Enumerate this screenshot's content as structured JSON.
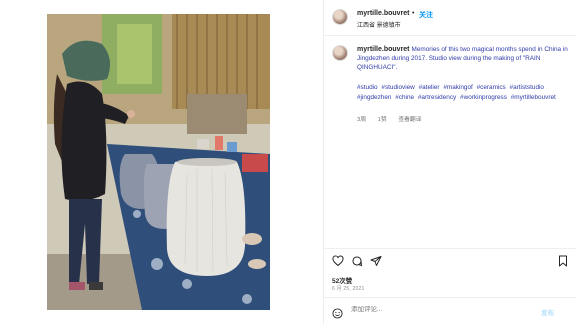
{
  "post": {
    "username": "myrtille.bouvret",
    "follow_label": "关注",
    "location": "江西省 景德镇市",
    "caption": "Memories of this two magical months spend in China in Jingdezhen during 2017. Studio view during the making of \"RAIN QINGHUACI\".",
    "hashtags": [
      "#studio",
      "#studioview",
      "#atelier",
      "#makingof",
      "#ceramics",
      "#artiststudio",
      "#jingdezhen",
      "#chine",
      "#artresidency",
      "#workinprogress",
      "#myrtillebouvret"
    ],
    "caption_time": "3周",
    "caption_likes": "1赞",
    "reply_label": "查看翻译",
    "likes": "52次赞",
    "date": "6 月 25, 2021",
    "comment_placeholder": "添加评论...",
    "post_button": "发布"
  },
  "icons": {
    "like": "heart-icon",
    "comment": "comment-icon",
    "share": "share-icon",
    "save": "bookmark-icon",
    "emoji": "smile-icon"
  },
  "colors": {
    "link": "#2f3ba8",
    "follow": "#0095f6",
    "muted": "#8e8e8e"
  }
}
